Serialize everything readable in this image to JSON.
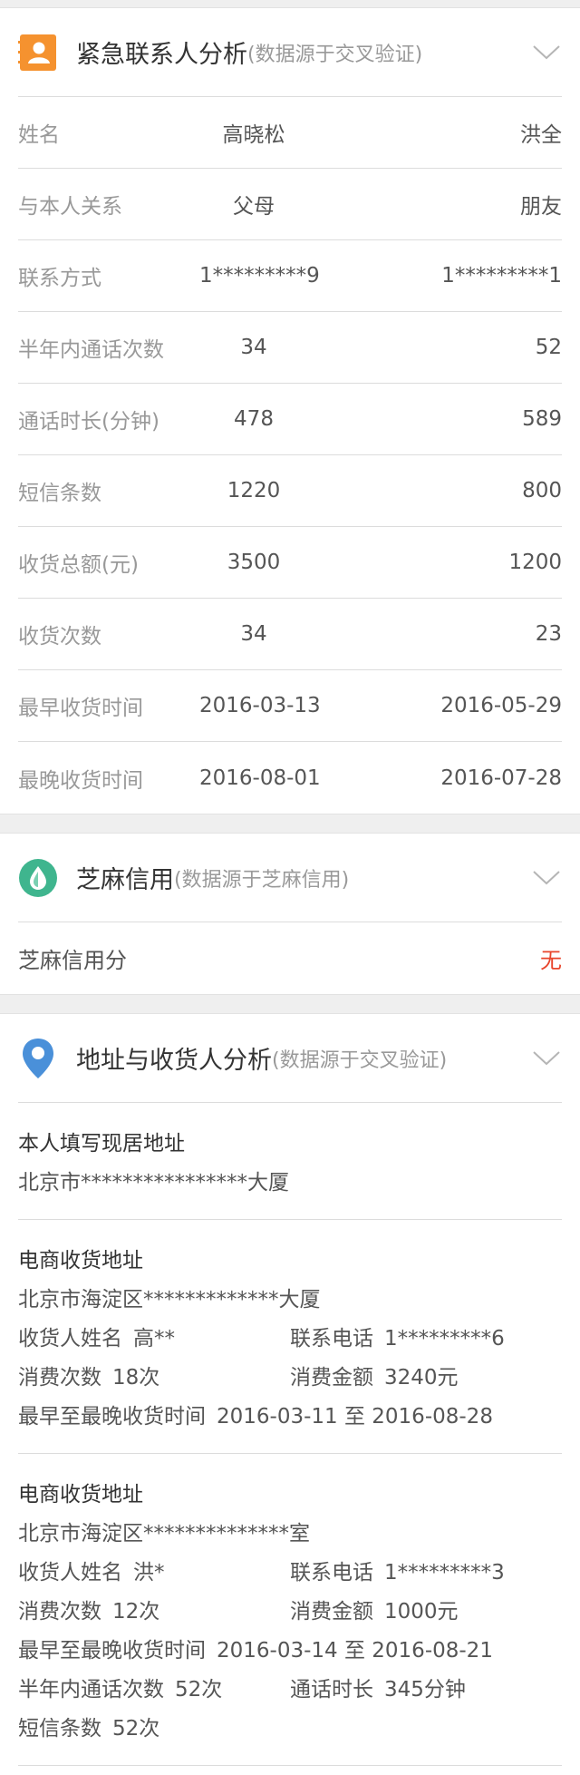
{
  "emergency_contacts": {
    "title": "紧急联系人分析",
    "subtitle": "(数据源于交叉验证)",
    "icon": "contact-card-icon",
    "icon_color": "#f5922f",
    "rows": [
      {
        "label": "姓名",
        "a": "高晓松",
        "b": "洪全"
      },
      {
        "label": "与本人关系",
        "a": "父母",
        "b": "朋友"
      },
      {
        "label": "联系方式",
        "a": "1*********9",
        "b": "1*********1"
      },
      {
        "label": "半年内通话次数",
        "a": "34",
        "b": "52"
      },
      {
        "label": "通话时长(分钟)",
        "a": "478",
        "b": "589"
      },
      {
        "label": "短信条数",
        "a": "1220",
        "b": "800"
      },
      {
        "label": "收货总额(元)",
        "a": "3500",
        "b": "1200"
      },
      {
        "label": "收货次数",
        "a": "34",
        "b": "23"
      },
      {
        "label": "最早收货时间",
        "a": "2016-03-13",
        "b": "2016-05-29"
      },
      {
        "label": "最晚收货时间",
        "a": "2016-08-01",
        "b": "2016-07-28"
      }
    ]
  },
  "zhima": {
    "title": "芝麻信用",
    "subtitle": "(数据源于芝麻信用)",
    "icon": "sesame-drop-icon",
    "icon_color": "#3fb58e",
    "score_label": "芝麻信用分",
    "score_value": "无",
    "score_value_color": "#e8452c"
  },
  "address": {
    "title": "地址与收货人分析",
    "subtitle": "(数据源于交叉验证)",
    "icon": "location-pin-icon",
    "icon_color": "#4a90d9",
    "home": {
      "title": "本人填写现居地址",
      "address": "北京市****************大厦"
    },
    "ecommerce": [
      {
        "title": "电商收货地址",
        "address": "北京市海淀区*************大厦",
        "receiver_label": "收货人姓名",
        "receiver": "高**",
        "phone_label": "联系电话",
        "phone": "1*********6",
        "count_label": "消费次数",
        "count": "18次",
        "amount_label": "消费金额",
        "amount": "3240元",
        "range_label": "最早至最晚收货时间",
        "range": "2016-03-11 至 2016-08-28"
      },
      {
        "title": "电商收货地址",
        "address": "北京市海淀区**************室",
        "receiver_label": "收货人姓名",
        "receiver": "洪*",
        "phone_label": "联系电话",
        "phone": "1*********3",
        "count_label": "消费次数",
        "count": "12次",
        "amount_label": "消费金额",
        "amount": "1000元",
        "range_label": "最早至最晚收货时间",
        "range": "2016-03-14 至 2016-08-21",
        "calls_label": "半年内通话次数",
        "calls": "52次",
        "duration_label": "通话时长",
        "duration": "345分钟",
        "sms_label": "短信条数",
        "sms": "52次"
      }
    ]
  }
}
